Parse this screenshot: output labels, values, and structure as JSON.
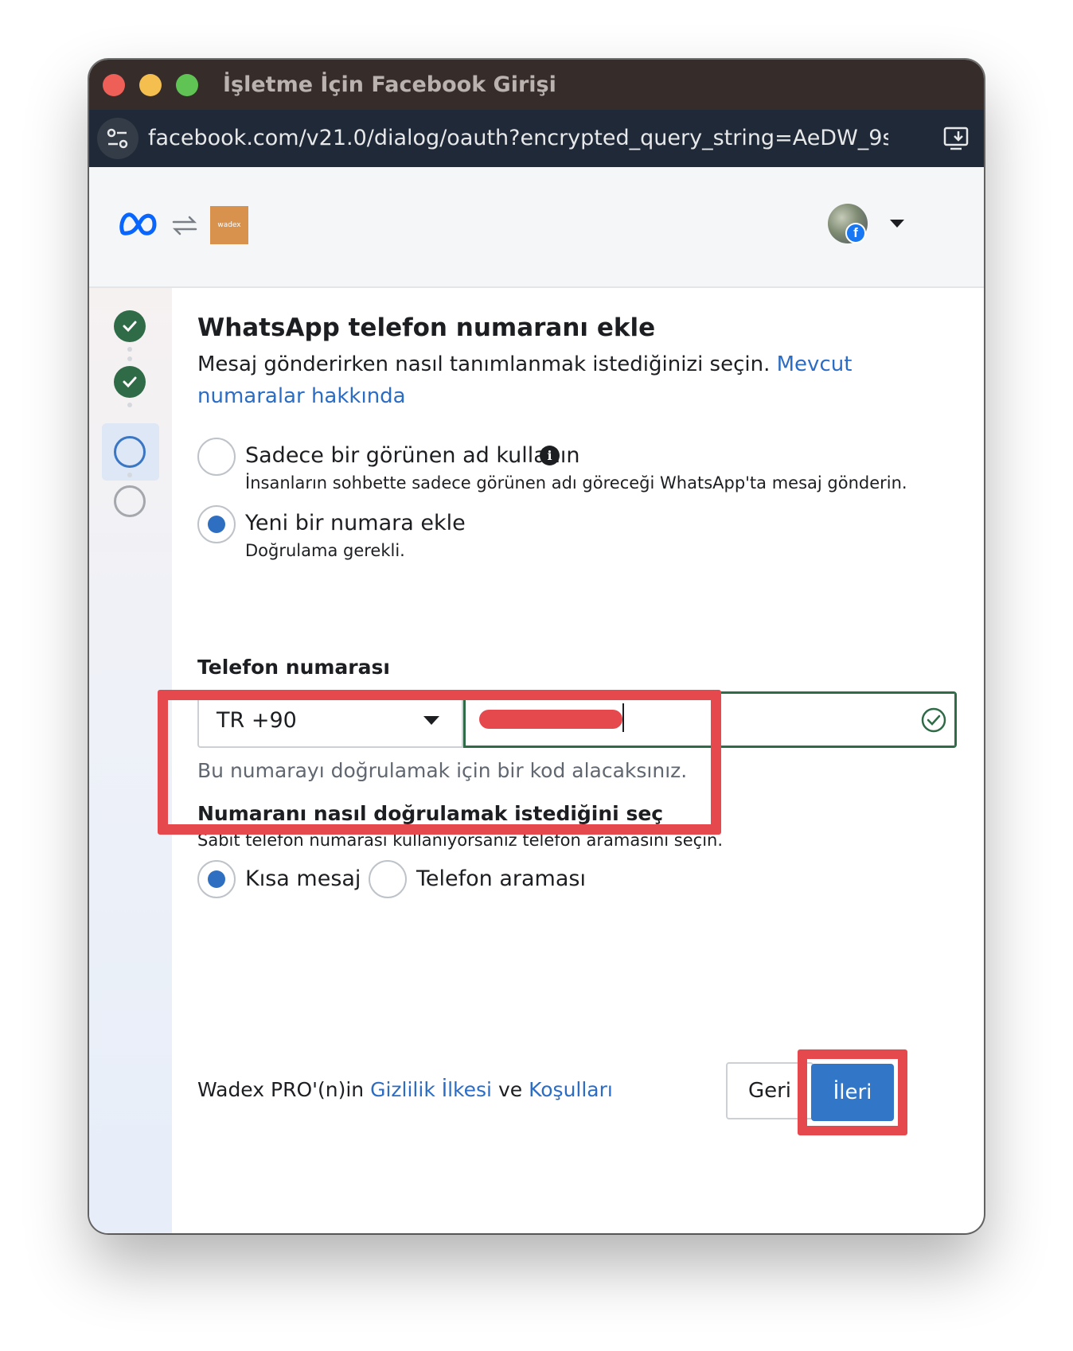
{
  "window": {
    "title": "İşletme İçin Facebook Girişi",
    "url": "facebook.com/v21.0/dialog/oauth?encrypted_query_string=AeDW_9sl..."
  },
  "header": {
    "app_logo_text": "wadex"
  },
  "steps": [
    {
      "state": "completed"
    },
    {
      "state": "completed"
    },
    {
      "state": "current"
    },
    {
      "state": "pending"
    }
  ],
  "main": {
    "title": "WhatsApp telefon numaranı ekle",
    "subtitle": "Mesaj gönderirken nasıl tanımlanmak istediğinizi seçin.",
    "subtitle_link": "Mevcut numaralar hakkında",
    "options": [
      {
        "label": "Sadece bir görünen ad kullanın",
        "description": "İnsanların sohbette sadece görünen adı göreceği WhatsApp'ta mesaj gönderin.",
        "selected": false
      },
      {
        "label": "Yeni bir numara ekle",
        "description": "Doğrulama gerekli.",
        "selected": true
      }
    ],
    "phone": {
      "label": "Telefon numarası",
      "country": "TR +90",
      "helper": "Bu numarayı doğrulamak için bir kod alacaksınız."
    },
    "verify": {
      "title": "Numaranı nasıl doğrulamak istediğini seç",
      "subtitle": "Sabit telefon numarası kullanıyorsanız telefon aramasını seçin.",
      "methods": [
        {
          "label": "Kısa mesaj",
          "selected": true
        },
        {
          "label": "Telefon araması",
          "selected": false
        }
      ]
    }
  },
  "footer": {
    "prefix": "Wadex PRO'(n)in",
    "privacy_link": "Gizlilik İlkesi",
    "conjunction": "ve",
    "terms_link": "Koşulları",
    "back_label": "Geri",
    "next_label": "İleri"
  },
  "colors": {
    "primary": "#3276c7",
    "link": "#2b6cc4",
    "success": "#2f6b47",
    "highlight": "#e5484d"
  }
}
